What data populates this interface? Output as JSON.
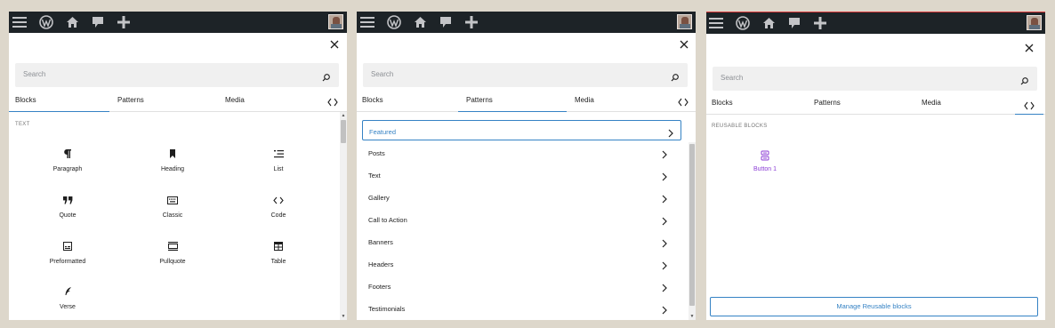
{
  "panels": [
    {
      "search_placeholder": "Search",
      "tabs": [
        "Blocks",
        "Patterns",
        "Media"
      ],
      "active_tab": "Blocks",
      "category": "TEXT",
      "blocks": [
        {
          "label": "Paragraph",
          "icon": "paragraph-icon"
        },
        {
          "label": "Heading",
          "icon": "heading-icon"
        },
        {
          "label": "List",
          "icon": "list-icon"
        },
        {
          "label": "Quote",
          "icon": "quote-icon"
        },
        {
          "label": "Classic",
          "icon": "classic-icon"
        },
        {
          "label": "Code",
          "icon": "code-icon"
        },
        {
          "label": "Preformatted",
          "icon": "preformatted-icon"
        },
        {
          "label": "Pullquote",
          "icon": "pullquote-icon"
        },
        {
          "label": "Table",
          "icon": "table-icon"
        },
        {
          "label": "Verse",
          "icon": "verse-icon"
        }
      ]
    },
    {
      "search_placeholder": "Search",
      "tabs": [
        "Blocks",
        "Patterns",
        "Media"
      ],
      "active_tab": "Patterns",
      "pattern_categories": [
        "Featured",
        "Posts",
        "Text",
        "Gallery",
        "Call to Action",
        "Banners",
        "Headers",
        "Footers",
        "Testimonials"
      ],
      "selected_category": "Featured"
    },
    {
      "search_placeholder": "Search",
      "tabs": [
        "Blocks",
        "Patterns",
        "Media"
      ],
      "active_tab": "reusable",
      "category": "REUSABLE BLOCKS",
      "reusable_blocks": [
        {
          "label": "Button 1",
          "icon": "reusable-block-icon"
        }
      ],
      "manage_label": "Manage Reusable blocks"
    }
  ],
  "colors": {
    "accent": "#3582c4",
    "adminbar": "#1d2327",
    "reusable_icon": "#8c3ed6",
    "background": "#ddd7cb"
  }
}
